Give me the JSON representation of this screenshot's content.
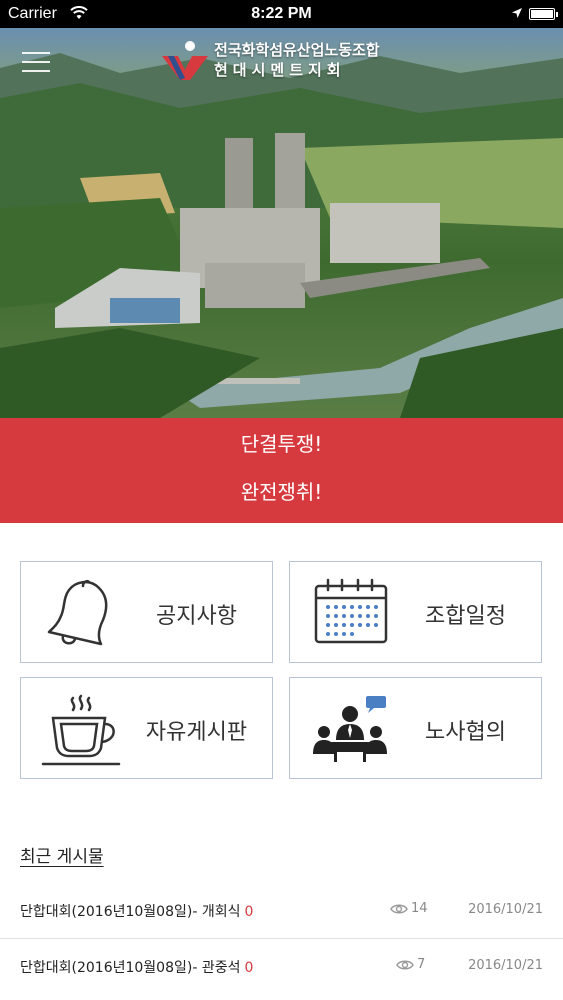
{
  "status_bar": {
    "carrier": "Carrier",
    "time": "8:22 PM"
  },
  "header": {
    "title_line1": "전국화학섬유산업노동조합",
    "title_line2": "현대시멘트지회"
  },
  "banner": {
    "line1": "단결투쟁!",
    "line2": "완전쟁취!",
    "color": "#d63a3f"
  },
  "menu_tiles": [
    {
      "label": "공지사항",
      "icon": "bell-icon"
    },
    {
      "label": "조합일정",
      "icon": "calendar-icon"
    },
    {
      "label": "자유게시판",
      "icon": "coffee-cup-icon"
    },
    {
      "label": "노사협의",
      "icon": "meeting-icon"
    }
  ],
  "recent": {
    "title": "최근 게시물",
    "posts": [
      {
        "title": "단합대회(2016년10월08일)- 개회식",
        "comments": "0",
        "views": "14",
        "date": "2016/10/21"
      },
      {
        "title": "단합대회(2016년10월08일)- 관중석",
        "comments": "0",
        "views": "7",
        "date": "2016/10/21"
      }
    ]
  }
}
